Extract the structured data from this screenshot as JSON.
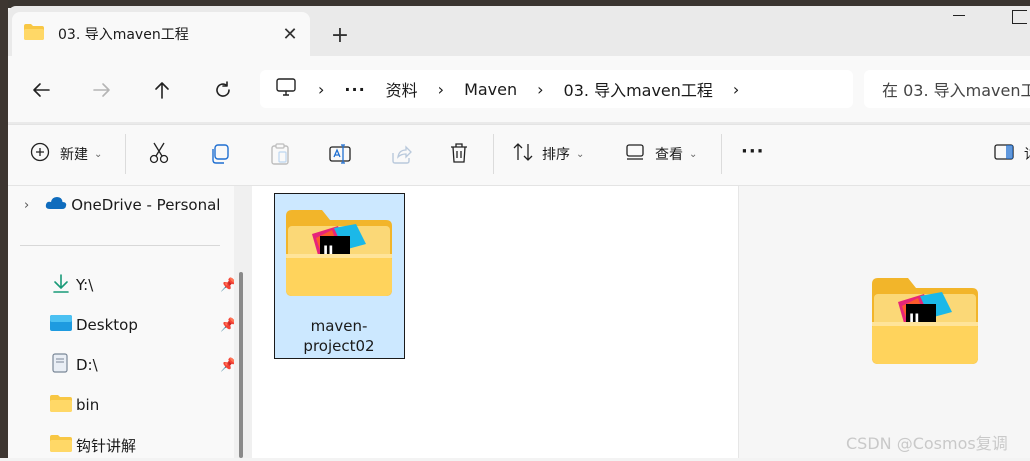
{
  "tab": {
    "title": "03. 导入maven工程",
    "close_glyph": "✕",
    "new_tab_glyph": "+"
  },
  "nav": {
    "back": "back-arrow",
    "forward": "forward-arrow",
    "up": "up-arrow",
    "refresh": "refresh"
  },
  "address": {
    "more": "···",
    "crumbs": [
      "资料",
      "Maven",
      "03. 导入maven工程"
    ],
    "sep": "›"
  },
  "search": {
    "placeholder": "在 03. 导入maven工"
  },
  "toolbar": {
    "new_label": "新建",
    "sort_label": "排序",
    "view_label": "查看",
    "more_label": "···",
    "details_label": "详"
  },
  "sidebar": {
    "onedrive": "OneDrive - Personal",
    "items": [
      {
        "label": "Y:\\",
        "icon": "download-icon",
        "pinned": true
      },
      {
        "label": "Desktop",
        "icon": "desktop-icon",
        "pinned": true
      },
      {
        "label": "D:\\",
        "icon": "drive-icon",
        "pinned": true
      },
      {
        "label": "bin",
        "icon": "folder-icon",
        "pinned": false
      },
      {
        "label": "钩针讲解",
        "icon": "folder-icon",
        "pinned": false
      }
    ]
  },
  "files": [
    {
      "name": "maven-project02",
      "selected": true
    }
  ],
  "watermark": "CSDN @Cosmos复调",
  "colors": {
    "accent": "#0067c0",
    "selection": "#cce8ff",
    "folder": "#f8c744"
  }
}
